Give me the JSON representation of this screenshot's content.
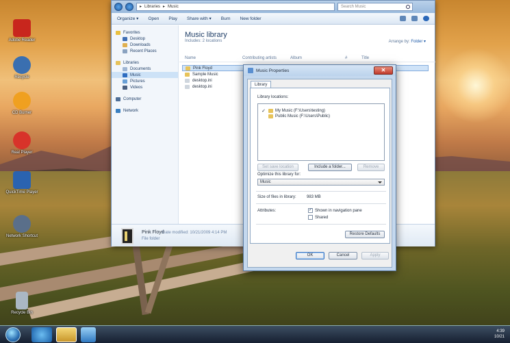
{
  "desktop": {
    "icons": [
      {
        "label": "Adobe Reader"
      },
      {
        "label": "Recycle"
      },
      {
        "label": "CD Burner"
      },
      {
        "label": "Real Player"
      },
      {
        "label": "QuickTime Player"
      },
      {
        "label": "Network Shortcut"
      },
      {
        "label": "Recycle Bin"
      }
    ]
  },
  "explorer": {
    "breadcrumb": [
      "Libraries",
      "Music"
    ],
    "search_placeholder": "Search Music",
    "toolbar": {
      "organize": "Organize ▾",
      "open": "Open",
      "play": "Play",
      "share_with": "Share with ▾",
      "burn": "Burn",
      "new_folder": "New folder"
    },
    "nav": {
      "favorites": "Favorites",
      "desktop": "Desktop",
      "downloads": "Downloads",
      "recent_places": "Recent Places",
      "libraries": "Libraries",
      "documents": "Documents",
      "music": "Music",
      "pictures": "Pictures",
      "videos": "Videos",
      "computer": "Computer",
      "network": "Network"
    },
    "library_title": "Music library",
    "library_subtitle": "Includes: 2 locations",
    "arrange_by_label": "Arrange by:",
    "arrange_by_value": "Folder ▾",
    "columns": {
      "name": "Name",
      "artists": "Contributing artists",
      "album": "Album",
      "num": "#",
      "title": "Title"
    },
    "files": [
      {
        "name": "Pink Floyd",
        "type": "folder",
        "selected": true
      },
      {
        "name": "Sample Music",
        "type": "folder",
        "selected": false
      },
      {
        "name": "desktop.ini",
        "type": "file",
        "selected": false
      },
      {
        "name": "desktop.ini",
        "type": "file",
        "selected": false
      }
    ],
    "details": {
      "name": "Pink Floyd",
      "meta": "Date modified: 10/21/2009 4:14 PM",
      "type": "File folder"
    }
  },
  "dialog": {
    "title": "Music Properties",
    "tab": "Library",
    "library_locations_label": "Library locations:",
    "locations": [
      {
        "checked": true,
        "text": "My Music (F:\\Users\\testing)"
      },
      {
        "checked": false,
        "text": "Public Music (F:\\Users\\Public)"
      }
    ],
    "set_save_location": "Set save location",
    "include_folder": "Include a folder...",
    "remove": "Remove",
    "optimize_label": "Optimize this library for:",
    "optimize_value": "Music",
    "size_label": "Size of files in library:",
    "size_value": "983 MB",
    "attributes_label": "Attributes:",
    "show_in_nav": "Shown in navigation pane",
    "shared": "Shared",
    "restore_defaults": "Restore Defaults",
    "ok": "OK",
    "cancel": "Cancel",
    "apply": "Apply"
  },
  "taskbar": {
    "time": "4:39",
    "date": "10/21"
  },
  "colors": {
    "accent": "#1e5aa8",
    "selection": "#cfe3f8",
    "close_red": "#c0392b"
  }
}
